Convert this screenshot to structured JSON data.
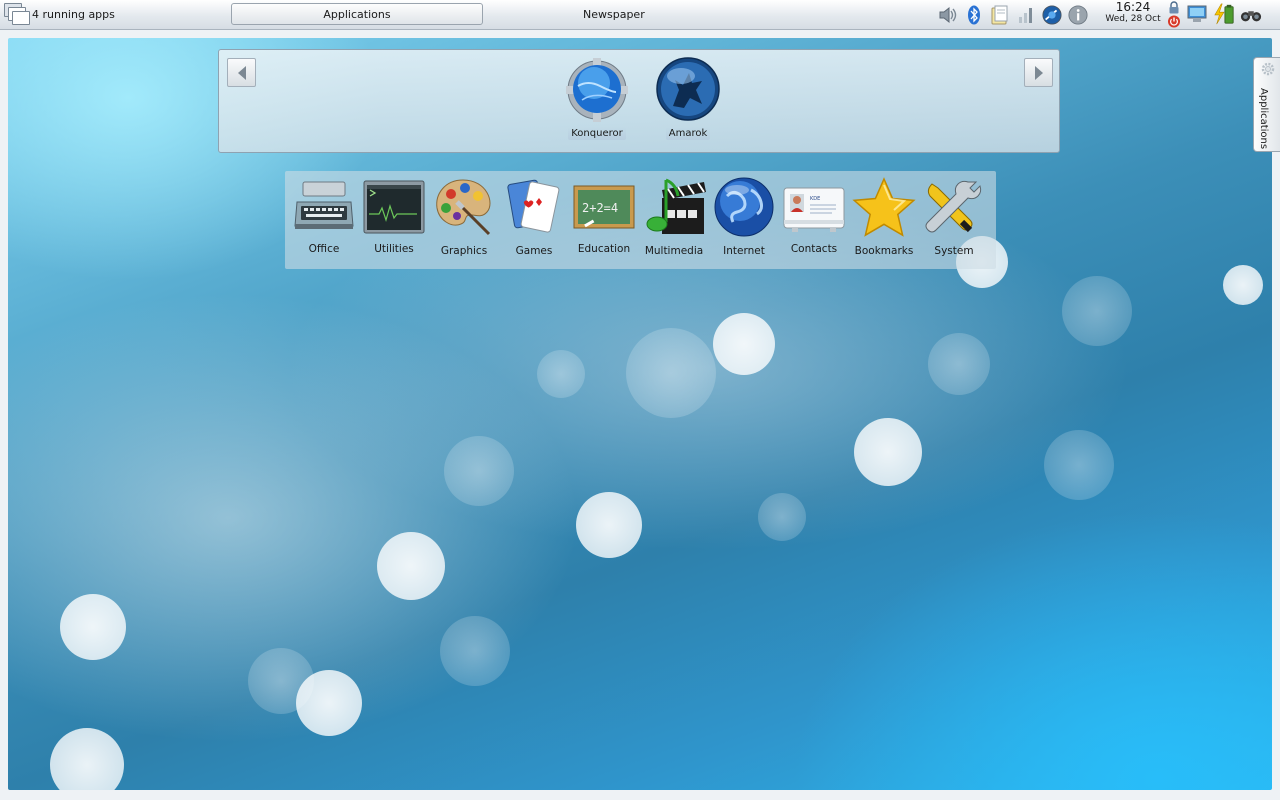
{
  "panel": {
    "running_apps": "4 running apps",
    "applications_button": "Applications",
    "current_activity": "Newspaper",
    "clock_time": "16:24",
    "clock_date": "Wed, 28 Oct"
  },
  "tray_icons": [
    "volume-icon",
    "bluetooth-icon",
    "clipboard-icon",
    "network-icon",
    "konqueror-small-icon",
    "info-icon",
    "lock-icon",
    "power-icon",
    "display-icon",
    "battery-icon",
    "binoculars-icon"
  ],
  "favorites": [
    {
      "label": "Konqueror",
      "icon": "konqueror-icon"
    },
    {
      "label": "Amarok",
      "icon": "amarok-icon"
    }
  ],
  "categories": [
    {
      "label": "Office",
      "icon": "typewriter-icon"
    },
    {
      "label": "Utilities",
      "icon": "terminal-icon"
    },
    {
      "label": "Graphics",
      "icon": "palette-icon"
    },
    {
      "label": "Games",
      "icon": "cards-icon"
    },
    {
      "label": "Education",
      "icon": "chalkboard-icon"
    },
    {
      "label": "Multimedia",
      "icon": "clapperboard-icon"
    },
    {
      "label": "Internet",
      "icon": "globe-icon"
    },
    {
      "label": "Contacts",
      "icon": "contact-card-icon"
    },
    {
      "label": "Bookmarks",
      "icon": "star-icon"
    },
    {
      "label": "System",
      "icon": "tools-icon"
    }
  ],
  "side_tab": {
    "label": "Applications"
  },
  "colors": {
    "accent": "#2c8fc0",
    "panel_bg": "#e4e9ee"
  }
}
